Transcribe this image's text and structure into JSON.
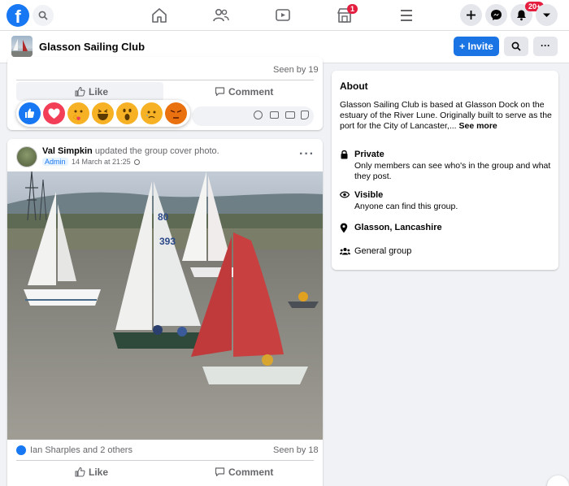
{
  "nav": {
    "brand_letter": "f",
    "notification_badges": {
      "marketplace": "1",
      "notifications": "20+"
    }
  },
  "group": {
    "name": "Glasson Sailing Club",
    "invite_label": "Invite",
    "invite_icon": "+",
    "more_label": "···"
  },
  "prev_post": {
    "seen_by": "Seen by 19",
    "like_label": "Like",
    "comment_label": "Comment"
  },
  "post": {
    "author": "Val Simpkin",
    "action": "updated the group cover photo.",
    "role_badge": "Admin",
    "timestamp": "14 March at 21:25",
    "more_label": "···",
    "reactions_text": "Ian Sharples and 2 others",
    "seen_by": "Seen by 18",
    "like_label": "Like",
    "comment_label": "Comment"
  },
  "about": {
    "title": "About",
    "description": "Glasson Sailing Club is based at Glasson Dock on the estuary of the River Lune. Originally built to serve as the port for the City of Lancaster,...",
    "see_more": "See more",
    "private_title": "Private",
    "private_desc": "Only members can see who's in the group and what they post.",
    "visible_title": "Visible",
    "visible_desc": "Anyone can find this group.",
    "location": "Glasson, Lancashire",
    "group_type": "General group"
  },
  "colors": {
    "brand": "#1877f2",
    "invite": "#1b74e4",
    "badge": "#e41e3f"
  }
}
